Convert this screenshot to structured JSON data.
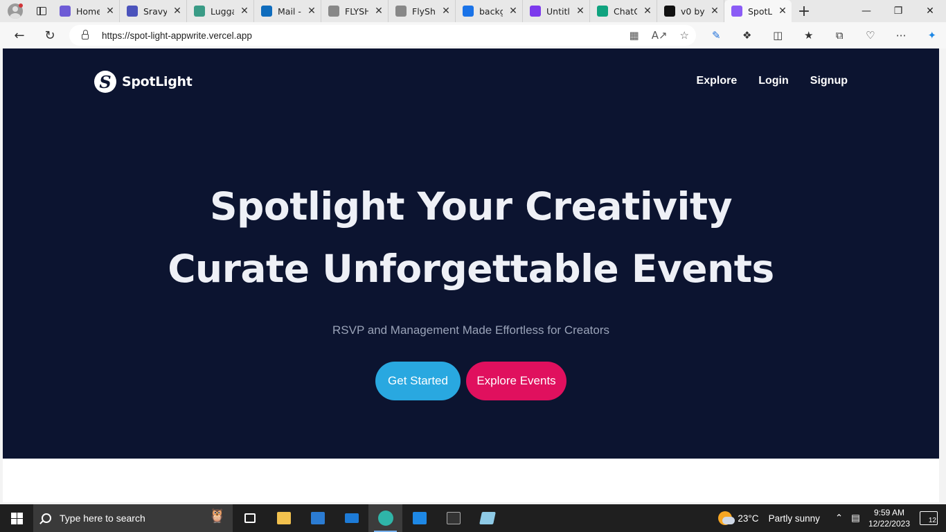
{
  "browser": {
    "tabs": [
      {
        "title": "Home",
        "favicon": "copilot-icon",
        "color": "#6e5bd6"
      },
      {
        "title": "Sravya",
        "favicon": "teams-icon",
        "color": "#4b53bc"
      },
      {
        "title": "Lugga",
        "favicon": "doc-d-icon",
        "color": "#3a9b86"
      },
      {
        "title": "Mail -",
        "favicon": "outlook-icon",
        "color": "#0f6cbd"
      },
      {
        "title": "FLYSH",
        "favicon": "plane-icon",
        "color": "#888888"
      },
      {
        "title": "FlySha",
        "favicon": "page-icon",
        "color": "#888888"
      },
      {
        "title": "backg",
        "favicon": "search-icon",
        "color": "#1a73e8"
      },
      {
        "title": "Untitl",
        "favicon": "heart-shield-icon",
        "color": "#7c3aed"
      },
      {
        "title": "ChatG",
        "favicon": "chatgpt-icon",
        "color": "#10a37f"
      },
      {
        "title": "v0 by",
        "favicon": "v0-icon",
        "color": "#111111"
      },
      {
        "title": "SpotL",
        "favicon": "spotlight-icon",
        "color": "#8b5cf6"
      }
    ],
    "url": "https://spot-light-appwrite.vercel.app"
  },
  "site": {
    "brand": "SpotLight",
    "brand_mark": "S",
    "nav": [
      "Explore",
      "Login",
      "Signup"
    ],
    "headline_line1": "Spotlight Your Creativity",
    "headline_line2": "Curate Unforgettable Events",
    "subheading": "RSVP and Management Made Effortless for Creators",
    "cta_primary": "Get Started",
    "cta_secondary": "Explore Events",
    "colors": {
      "background": "#0c1430",
      "primary": "#29a8e0",
      "secondary": "#e0105e"
    }
  },
  "taskbar": {
    "search_placeholder": "Type here to search",
    "weather_temp": "23°C",
    "weather_desc": "Partly sunny",
    "time": "9:59 AM",
    "date": "12/22/2023",
    "notifications": "12"
  }
}
